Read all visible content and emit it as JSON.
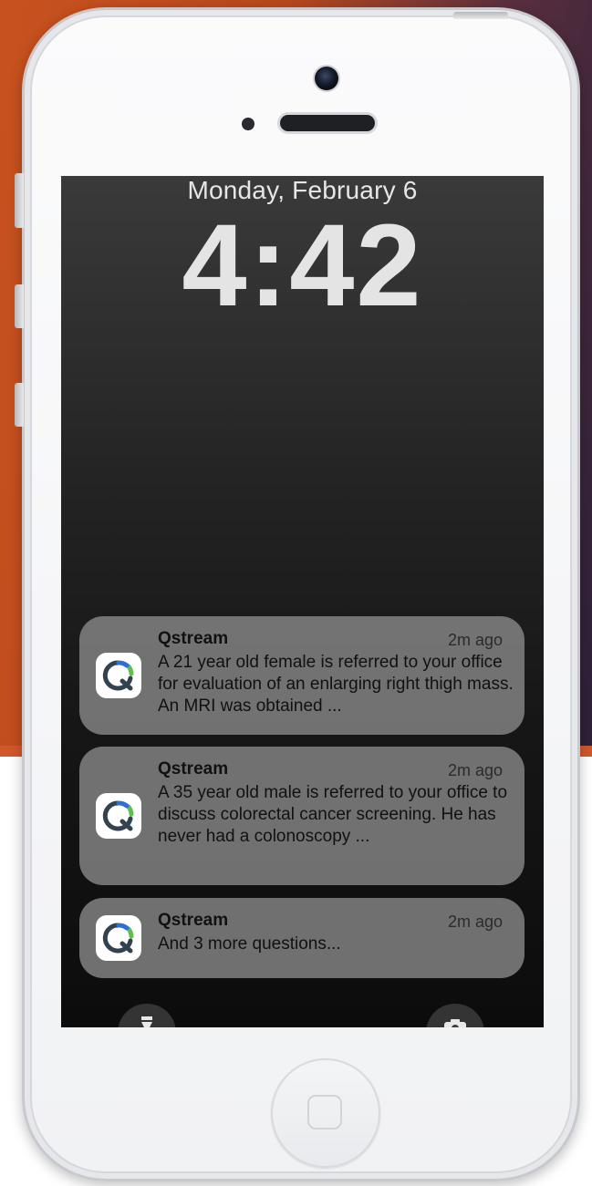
{
  "lockscreen": {
    "date": "Monday, February 6",
    "time": "4:42"
  },
  "notifications": [
    {
      "app": "Qstream",
      "ago": "2m ago",
      "body": "A 21 year old female is referred to your office for evaluation of an enlarging right thigh mass. An MRI was obtained ..."
    },
    {
      "app": "Qstream",
      "ago": "2m ago",
      "body": "A 35 year old male is referred to your office to discuss colorectal cancer screening. He has never had a colonoscopy ..."
    },
    {
      "app": "Qstream",
      "ago": "2m ago",
      "body": "And 3 more questions..."
    }
  ],
  "icons": {
    "app_icon": "qstream-app-icon",
    "flashlight": "flashlight-icon",
    "camera": "camera-icon",
    "home": "home-button"
  },
  "colors": {
    "background_left": "#c8521f",
    "background_right": "#2c2038",
    "qstream_blue": "#2d6fd6",
    "qstream_green": "#5cc04a",
    "qstream_dark": "#3a4a5a"
  }
}
